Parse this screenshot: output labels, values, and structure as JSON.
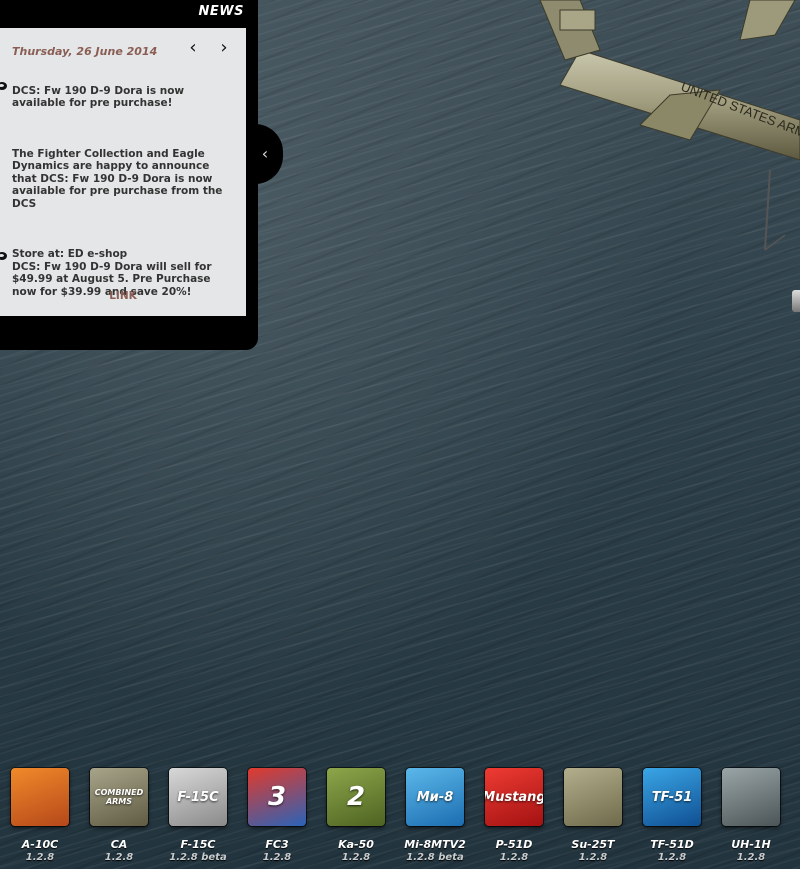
{
  "news": {
    "header": "NEWS",
    "date": "Thursday, 26 June 2014",
    "prev_icon": "chevron-left-icon",
    "next_icon": "chevron-right-icon",
    "paragraphs": [
      "DCS: Fw 190 D-9 Dora is now available for pre purchase!",
      "The Fighter Collection and Eagle Dynamics are happy to announce that DCS: Fw 190 D-9 Dora is now available for pre purchase from the DCS",
      "Store at: ED e-shop\nDCS: Fw 190 D-9 Dora will sell for $49.99 at August 5. Pre Purchase now for $39.99 and save 20%!"
    ],
    "link_label": "LINK",
    "collapse_icon": "chevron-left-icon"
  },
  "modules": [
    {
      "name": "A-10C",
      "version": "1.2.8",
      "tile_text": "",
      "color_top": "#f08a2a",
      "color_bottom": "#b5481a",
      "icon": "a10-aircraft-icon"
    },
    {
      "name": "CA",
      "version": "1.2.8",
      "tile_text": "COMBINED ARMS",
      "color_top": "#a7a48a",
      "color_bottom": "#5f5c43",
      "icon": "tank-icon"
    },
    {
      "name": "F-15C",
      "version": "1.2.8 beta",
      "tile_text": "F-15C",
      "color_top": "#d8d8d8",
      "color_bottom": "#8a8a8a",
      "icon": "f15-shield-icon"
    },
    {
      "name": "FC3",
      "version": "1.2.8",
      "tile_text": "3",
      "color_top": "#e23a2c",
      "color_bottom": "#2a63b8",
      "icon": "star-icon"
    },
    {
      "name": "Ka-50",
      "version": "1.2.8",
      "tile_text": "2",
      "color_top": "#8da64a",
      "color_bottom": "#4d6322",
      "icon": "helicopter-icon"
    },
    {
      "name": "Mi-8MTV2",
      "version": "1.2.8 beta",
      "tile_text": "Ми-8",
      "color_top": "#5bb8ea",
      "color_bottom": "#1c6db0",
      "icon": "helicopter-icon"
    },
    {
      "name": "P-51D",
      "version": "1.2.8",
      "tile_text": "Mustang",
      "color_top": "#ee3b33",
      "color_bottom": "#a31212",
      "icon": "p51-aircraft-icon"
    },
    {
      "name": "Su-25T",
      "version": "1.2.8",
      "tile_text": "",
      "color_top": "#b3ae8c",
      "color_bottom": "#6f6a4b",
      "icon": "su25-aircraft-icon"
    },
    {
      "name": "TF-51D",
      "version": "1.2.8",
      "tile_text": "TF-51",
      "color_top": "#3aa6e6",
      "color_bottom": "#0f4f92",
      "icon": "p51-aircraft-icon"
    },
    {
      "name": "UH-1H",
      "version": "1.2.8",
      "tile_text": "",
      "color_top": "#9aa5a8",
      "color_bottom": "#4b5557",
      "icon": "huey-helicopter-icon"
    }
  ]
}
